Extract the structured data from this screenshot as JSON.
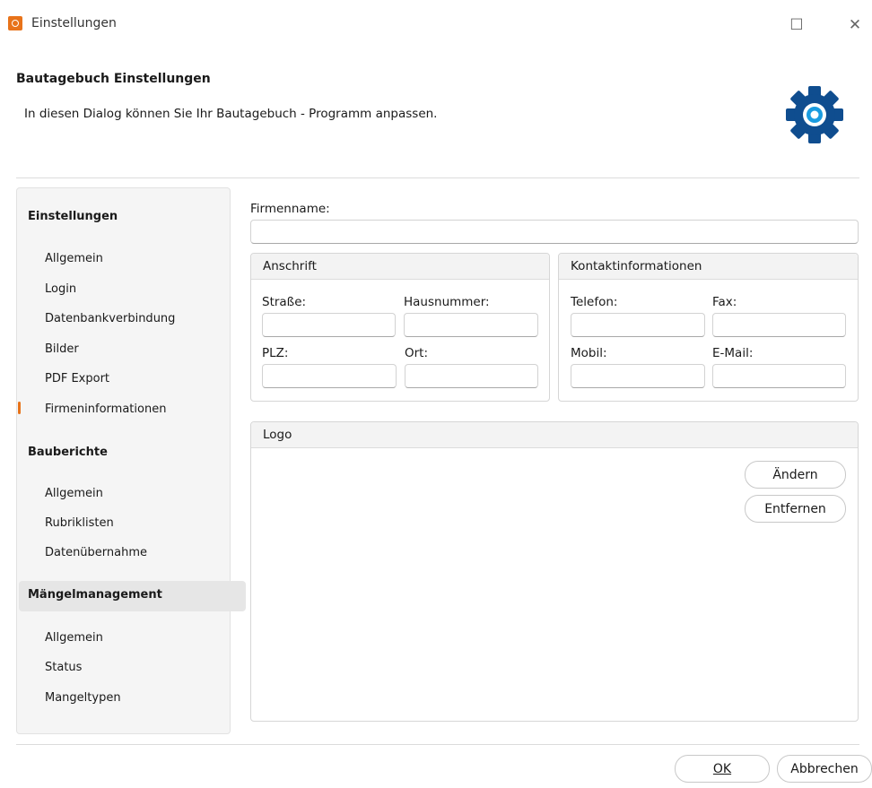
{
  "window": {
    "title": "Einstellungen",
    "maximize_glyph": "☐",
    "close_glyph": "✕"
  },
  "header": {
    "title": "Bautagebuch Einstellungen",
    "description": "In diesen Dialog können Sie Ihr Bautagebuch - Programm anpassen.",
    "icon": "gear-icon",
    "icon_color": "#0f4d8f"
  },
  "nav": {
    "groups": [
      {
        "label": "Einstellungen",
        "items": [
          "Allgemein",
          "Login",
          "Datenbankverbindung",
          "Bilder",
          "PDF Export",
          "Firmeninformationen"
        ]
      },
      {
        "label": "Bauberichte",
        "items": [
          "Allgemein",
          "Rubriklisten",
          "Datenübernahme"
        ]
      },
      {
        "label": "Mängelmanagement",
        "items": [
          "Allgemein",
          "Status",
          "Mangeltypen"
        ]
      }
    ],
    "active_item": "Firmeninformationen",
    "accent_color": "#e8731a"
  },
  "form": {
    "firmenname_label": "Firmenname:",
    "firmenname_value": "",
    "anschrift": {
      "title": "Anschrift",
      "strasse_label": "Straße:",
      "hausnummer_label": "Hausnummer:",
      "plz_label": "PLZ:",
      "ort_label": "Ort:"
    },
    "kontakt": {
      "title": "Kontaktinformationen",
      "telefon_label": "Telefon:",
      "fax_label": "Fax:",
      "mobil_label": "Mobil:",
      "email_label": "E-Mail:"
    },
    "logo": {
      "title": "Logo",
      "change_label": "Ändern",
      "remove_label": "Entfernen"
    }
  },
  "footer": {
    "ok_label": "OK",
    "cancel_label": "Abbrechen"
  }
}
